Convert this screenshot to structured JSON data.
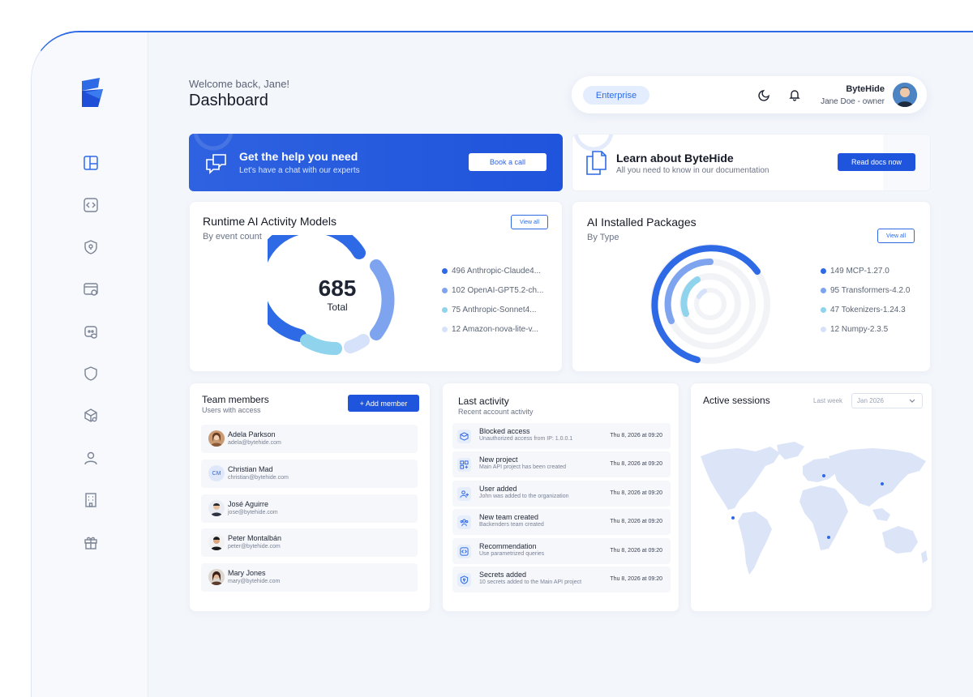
{
  "header": {
    "welcome": "Welcome back, Jane!",
    "title": "Dashboard",
    "plan": "Enterprise",
    "org": "ByteHide",
    "user": "Jane Doe - owner"
  },
  "sidebar": {
    "items": [
      {
        "icon": "dashboard-icon"
      },
      {
        "icon": "code-icon"
      },
      {
        "icon": "shield-lock-icon"
      },
      {
        "icon": "window-shield-icon"
      },
      {
        "icon": "bot-shield-icon"
      },
      {
        "icon": "shield-icon"
      },
      {
        "icon": "package-search-icon"
      },
      {
        "icon": "user-icon"
      },
      {
        "icon": "building-icon"
      },
      {
        "icon": "gift-icon"
      }
    ]
  },
  "help_banner": {
    "title": "Get the help you need",
    "subtitle": "Let's have a chat with our experts",
    "button": "Book a call"
  },
  "learn_banner": {
    "title": "Learn about ByteHide",
    "subtitle": "All you need to know in our documentation",
    "button": "Read docs now"
  },
  "runtime_card": {
    "title": "Runtime AI Activity Models",
    "subtitle": "By event count",
    "view_all": "View all",
    "total_value": "685",
    "total_label": "Total",
    "legend": [
      {
        "label": "496 Anthropic-Claude4...",
        "color": "#2f6ae6"
      },
      {
        "label": "102 OpenAI-GPT5.2-ch...",
        "color": "#7ea4ef"
      },
      {
        "label": "75 Anthropic-Sonnet4...",
        "color": "#8fd4ec"
      },
      {
        "label": "12 Amazon-nova-lite-v...",
        "color": "#d6e2fa"
      }
    ]
  },
  "packages_card": {
    "title": "AI Installed Packages",
    "subtitle": "By Type",
    "view_all": "View all",
    "legend": [
      {
        "label": "149 MCP-1.27.0",
        "color": "#2f6ae6"
      },
      {
        "label": "95 Transformers-4.2.0",
        "color": "#7ea4ef"
      },
      {
        "label": "47 Tokenizers-1.24.3",
        "color": "#8fd4ec"
      },
      {
        "label": "12 Numpy-2.3.5",
        "color": "#d6e2fa"
      }
    ]
  },
  "team_card": {
    "title": "Team members",
    "subtitle": "Users with access",
    "add_button": "+ Add member",
    "members": [
      {
        "name": "Adela Parkson",
        "email": "adela@bytehide.com",
        "initials": ""
      },
      {
        "name": "Christian Mad",
        "email": "christian@bytehide.com",
        "initials": "CM"
      },
      {
        "name": "José Aguirre",
        "email": "jose@bytehide.com",
        "initials": ""
      },
      {
        "name": "Peter Montalbán",
        "email": "peter@bytehide.com",
        "initials": ""
      },
      {
        "name": "Mary Jones",
        "email": "mary@bytehide.com",
        "initials": ""
      }
    ]
  },
  "activity_card": {
    "title": "Last activity",
    "subtitle": "Recent account activity",
    "items": [
      {
        "title": "Blocked access",
        "desc": "Unauthorized access from IP: 1.0.0.1",
        "time": "Thu 8, 2026 at 09:20",
        "icon": "cube-lock-icon"
      },
      {
        "title": "New project",
        "desc": "Main API project has been created",
        "time": "Thu 8, 2026 at 09:20",
        "icon": "grid-plus-icon"
      },
      {
        "title": "User added",
        "desc": "John was added to the organization",
        "time": "Thu 8, 2026 at 09:20",
        "icon": "user-plus-icon"
      },
      {
        "title": "New team created",
        "desc": "Backenders team created",
        "time": "Thu 8, 2026 at 09:20",
        "icon": "users-icon"
      },
      {
        "title": "Recommendation",
        "desc": "Use parametrized queries",
        "time": "Thu 8, 2026 at 09:20",
        "icon": "code-box-icon"
      },
      {
        "title": "Secrets added",
        "desc": "10 secrets added to the Main API project",
        "time": "Thu 8, 2026 at 09:20",
        "icon": "shield-key-icon"
      }
    ]
  },
  "sessions_card": {
    "title": "Active sessions",
    "period_label": "Last week",
    "period_value": "Jan 2026"
  }
}
